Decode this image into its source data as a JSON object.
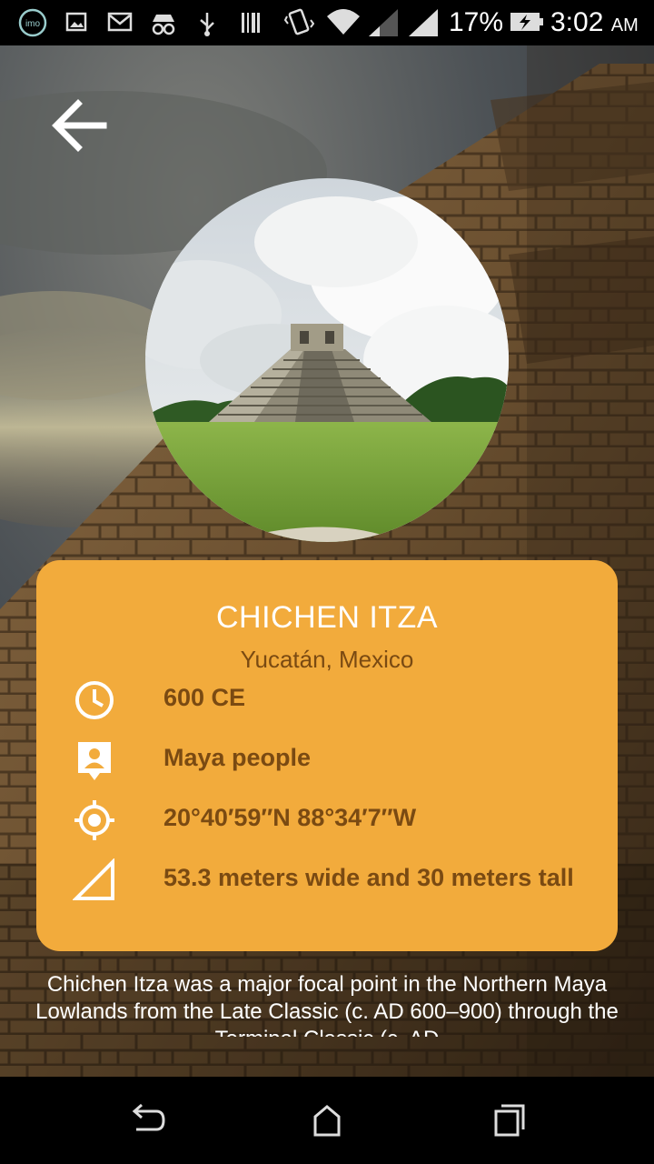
{
  "status_bar": {
    "battery_percent": "17%",
    "time": "3:02",
    "ampm": "AM",
    "icons": [
      "imo-icon",
      "image-icon",
      "mail-icon",
      "incognito-icon",
      "usb-icon",
      "barcode-icon",
      "vibrate-icon",
      "wifi-icon",
      "signal-icon",
      "signal-icon",
      "battery-charging-icon"
    ]
  },
  "header": {
    "back_icon": "arrow-left-icon"
  },
  "place": {
    "name": "CHICHEN ITZA",
    "location": "Yucatán, Mexico",
    "details": [
      {
        "icon": "clock-icon",
        "text": "600 CE"
      },
      {
        "icon": "person-badge-icon",
        "text": "Maya people"
      },
      {
        "icon": "gps-target-icon",
        "text": "20°40′59″N 88°34′7″W"
      },
      {
        "icon": "triangle-ruler-icon",
        "text": "53.3 meters wide and 30 meters tall"
      }
    ],
    "description": "Chichen Itza was a major focal point in the Northern Maya Lowlands from the Late Classic (c. AD 600–900) through the Terminal Classic (c. AD"
  },
  "colors": {
    "card": "#f2ab3c",
    "card_text": "#7a4a12",
    "title": "#ffffff"
  },
  "nav_bar": {
    "icons": [
      "back-nav-icon",
      "home-nav-icon",
      "recents-nav-icon"
    ]
  }
}
